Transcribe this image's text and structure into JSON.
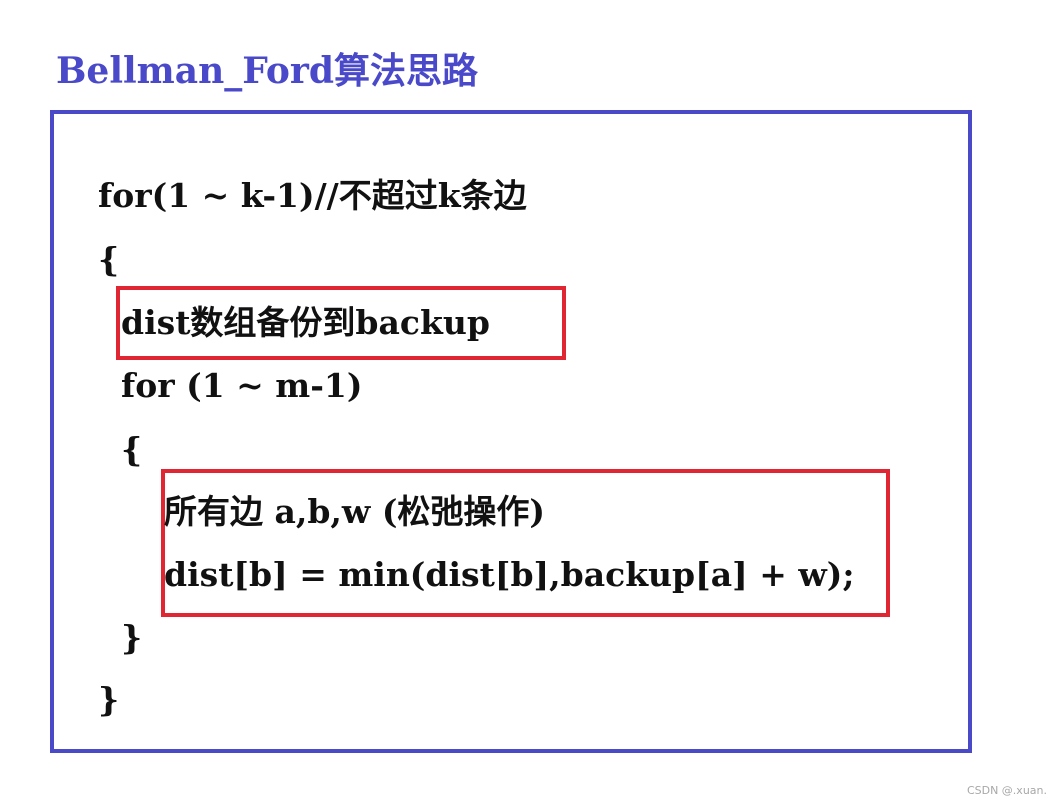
{
  "title": "Bellman_Ford算法思路",
  "code": {
    "outer_for": "for(1 ~ k-1)//不超过k条边",
    "outer_open": "{",
    "backup_step": "dist数组备份到backup",
    "inner_for": "for (1 ~ m-1)",
    "inner_open": "{",
    "relax_edges": "所有边 a,b,w (松弛操作)",
    "relax_update": "dist[b] = min(dist[b],backup[a] + w);",
    "inner_close": "}",
    "outer_close": "}"
  },
  "watermark": "CSDN @.xuan.",
  "colors": {
    "title": "#4949c9",
    "frame_border": "#4a4ac8",
    "highlight_border": "#e02633",
    "code_text": "#111111"
  }
}
